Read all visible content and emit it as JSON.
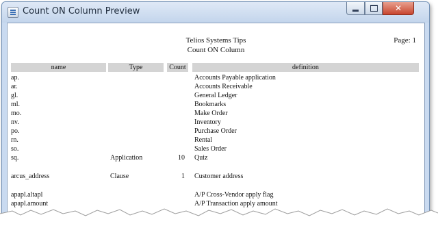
{
  "window": {
    "title": "Count ON Column Preview",
    "icon": "document-icon",
    "buttons": {
      "minimize": "minimize-icon",
      "maximize": "maximize-icon",
      "close": "close-icon"
    }
  },
  "report": {
    "company": "Telios Systems Tips",
    "title": "Count ON Column",
    "page_label": "Page: 1",
    "columns": {
      "name": "name",
      "type": "Type",
      "count": "Count",
      "definition": "definition"
    },
    "rows": [
      {
        "name": "ap.",
        "type": "",
        "count": "",
        "definition": "Accounts Payable application"
      },
      {
        "name": "ar.",
        "type": "",
        "count": "",
        "definition": "Accounts Receivable"
      },
      {
        "name": "gl.",
        "type": "",
        "count": "",
        "definition": "General Ledger"
      },
      {
        "name": "ml.",
        "type": "",
        "count": "",
        "definition": "Bookmarks"
      },
      {
        "name": "mo.",
        "type": "",
        "count": "",
        "definition": "Make Order"
      },
      {
        "name": "nv.",
        "type": "",
        "count": "",
        "definition": "Inventory"
      },
      {
        "name": "po.",
        "type": "",
        "count": "",
        "definition": "Purchase Order"
      },
      {
        "name": "rn.",
        "type": "",
        "count": "",
        "definition": "Rental"
      },
      {
        "name": "so.",
        "type": "",
        "count": "",
        "definition": "Sales Order"
      },
      {
        "name": "sq.",
        "type": "Application",
        "count": "10",
        "definition": "Quiz"
      },
      {
        "name": "arcus_address",
        "type": "Clause",
        "count": "1",
        "definition": "Customer address"
      },
      {
        "name": "apapl.altapl",
        "type": "",
        "count": "",
        "definition": "A/P Cross-Vendor apply flag"
      },
      {
        "name": "apapl.amount",
        "type": "",
        "count": "",
        "definition": "A/P Transaction apply amount"
      }
    ]
  }
}
